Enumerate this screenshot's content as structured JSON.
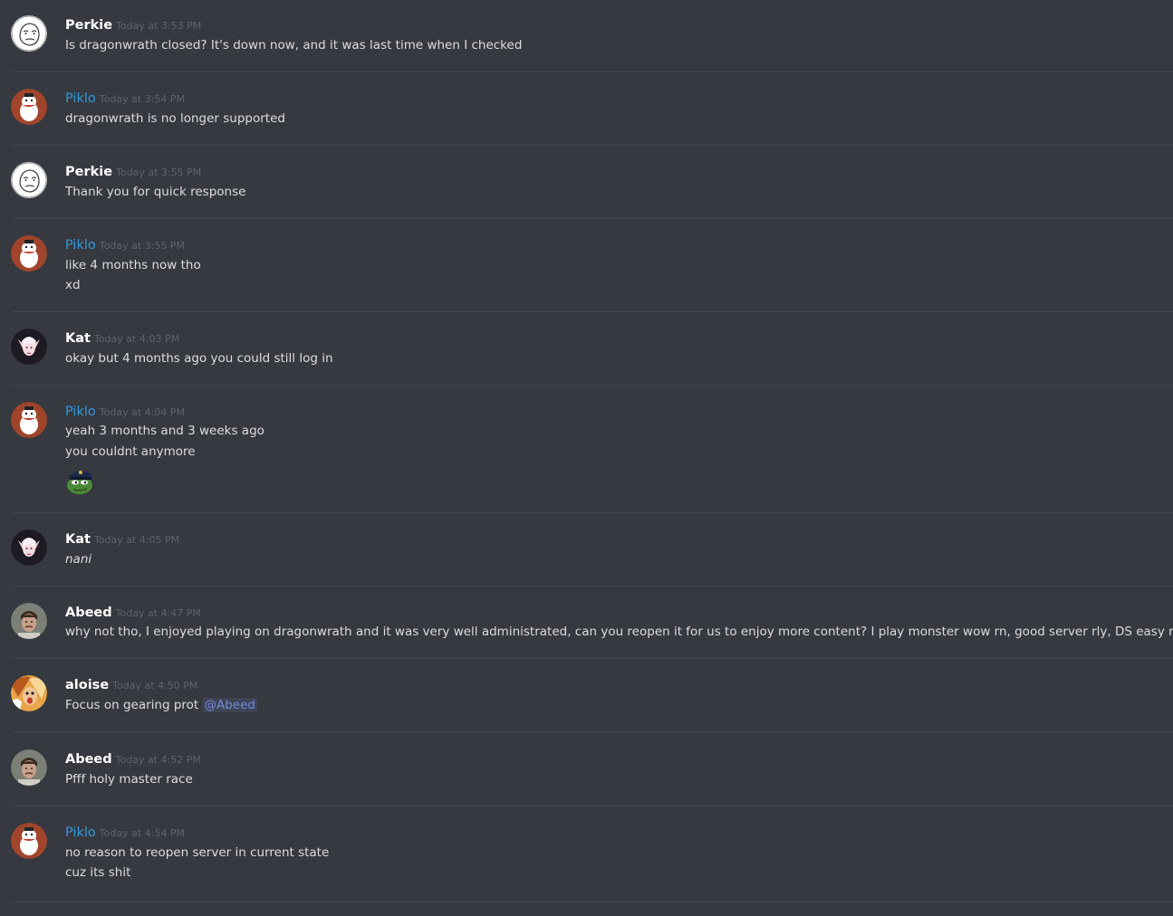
{
  "messages": [
    {
      "author": "Perkie",
      "time": "Today at 3:53 PM",
      "lines": [
        "Is dragonwrath closed? It's down now, and it was last time when I checked"
      ]
    },
    {
      "author": "Piklo",
      "time": "Today at 3:54 PM",
      "lines": [
        "dragonwrath is no longer supported"
      ]
    },
    {
      "author": "Perkie",
      "time": "Today at 3:55 PM",
      "lines": [
        "Thank you for quick response"
      ]
    },
    {
      "author": "Piklo",
      "time": "Today at 3:55 PM",
      "lines": [
        "like 4 months now tho",
        "xd"
      ]
    },
    {
      "author": "Kat",
      "time": "Today at 4:03 PM",
      "lines": [
        "okay but 4 months ago you could still log in"
      ]
    },
    {
      "author": "Piklo",
      "time": "Today at 4:04 PM",
      "lines": [
        "yeah 3 months and 3 weeks ago",
        "you couldnt anymore"
      ],
      "emoji": "pepe-police-emoji"
    },
    {
      "author": "Kat",
      "time": "Today at 4:05 PM",
      "lines": [
        "nani"
      ]
    },
    {
      "author": "Abeed",
      "time": "Today at 4:47 PM",
      "lines": [
        "why not tho, I enjoyed playing on dragonwrath and it was very well administrated, can you reopen it for us to enjoy more content? I play monster wow rn, good server rly, DS easy raid"
      ]
    },
    {
      "author": "aloise",
      "time": "Today at 4:50 PM",
      "lines": [
        "Focus on gearing prot"
      ],
      "mention": "@Abeed"
    },
    {
      "author": "Abeed",
      "time": "Today at 4:52 PM",
      "lines": [
        "Pfff holy master race"
      ]
    },
    {
      "author": "Piklo",
      "time": "Today at 4:54 PM",
      "lines": [
        "no reason to reopen server in current state",
        "cuz its shit"
      ]
    }
  ],
  "colors": {
    "background": "#36393f",
    "divider": "#42454b",
    "username_default": "#ffffff",
    "username_piklo": "#3498db",
    "timestamp": "#5f6369",
    "text": "#dcddde",
    "mention": "#7289da"
  },
  "avatars": {
    "Perkie": "wojak-avatar-icon",
    "Piklo": "penguin-avatar-icon",
    "Kat": "elf-avatar-icon",
    "Abeed": "man-portrait-avatar-icon",
    "aloise": "cartoon-face-avatar-icon"
  }
}
